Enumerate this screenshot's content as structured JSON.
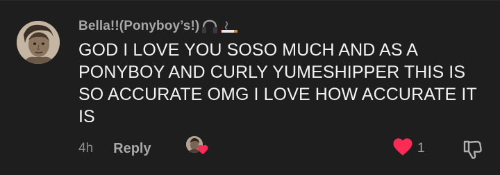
{
  "comment": {
    "username": "Bella!!(Ponyboy’s!)",
    "username_emojis": [
      "headphones-emoji",
      "cigarette-emoji"
    ],
    "text": "GOD I LOVE YOU SOSO MUCH AND AS A PONYBOY AND CURLY YUMESHIPPER THIS IS SO ACCURATE OMG I LOVE HOW ACCURATE IT IS",
    "timestamp": "4h",
    "reply_label": "Reply",
    "like_count": "1",
    "liked": true,
    "liked_by_creator": true
  },
  "colors": {
    "background": "#1e1e1f",
    "heart": "#fe2c55",
    "text": "#f2f2f2",
    "muted": "#a8a8a8"
  }
}
